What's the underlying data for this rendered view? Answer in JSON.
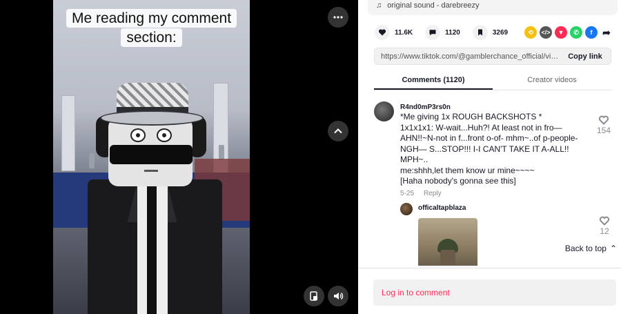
{
  "video": {
    "caption_line1": "Me reading my comment",
    "caption_line2": "section:",
    "more_icon": "more-horizontal-icon",
    "scroll_up_icon": "chevron-up-icon",
    "clip_icon": "picture-in-picture-icon",
    "volume_icon": "volume-icon"
  },
  "sound": {
    "label": "original sound - darebreezy",
    "icon": "music-note-icon"
  },
  "stats": {
    "likes": "11.6K",
    "comments": "1120",
    "saves": "3269"
  },
  "share": {
    "colors": {
      "repost": "#f4c20d",
      "embed": "#555555",
      "send": "#fe2c55",
      "whatsapp": "#25d366",
      "facebook": "#1877f2"
    }
  },
  "link": {
    "url": "https://www.tiktok.com/@gamblerchance_official/vide...",
    "copy_label": "Copy link"
  },
  "tabs": [
    {
      "label": "Comments (1120)",
      "active": true
    },
    {
      "label": "Creator videos",
      "active": false
    }
  ],
  "comments": [
    {
      "username": "R4nd0mP3rs0n",
      "text_lines": [
        "*Me giving 1x ROUGH BACKSHOTS *",
        "1x1x1x1: W-wait...Huh?! At least not in fro—",
        "AHN!!~N-not in f...front o-of- mhm~..of p-people-",
        "NGH— S...STOP!!! I-I CAN'T TAKE IT A-ALL!!",
        "MPH~..",
        "me:shhh,let them know ur mine~~~~",
        "[Haha nobody's gonna see this]"
      ],
      "date": "5-25",
      "reply_label": "Reply",
      "likes": "154"
    },
    {
      "username": "officaltapblaza",
      "likes": "12"
    }
  ],
  "back_to_top": "Back to top",
  "login_prompt": "Log in to comment",
  "colors": {
    "accent": "#fe2c55",
    "text": "#161823"
  }
}
